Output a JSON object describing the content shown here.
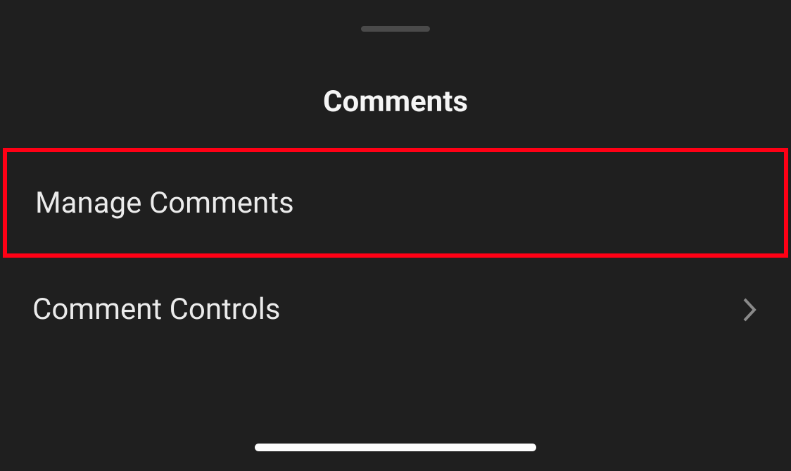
{
  "sheet": {
    "title": "Comments"
  },
  "menu": {
    "items": [
      {
        "label": "Manage Comments",
        "has_chevron": false,
        "highlighted": true
      },
      {
        "label": "Comment Controls",
        "has_chevron": true,
        "highlighted": false
      }
    ]
  }
}
